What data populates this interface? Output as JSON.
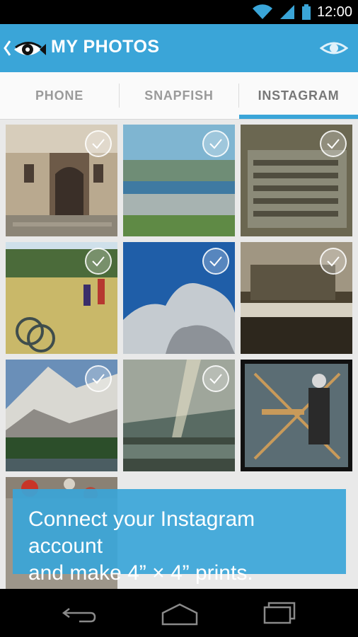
{
  "status_bar": {
    "time": "12:00"
  },
  "action_bar": {
    "title": "MY PHOTOS"
  },
  "tabs": [
    {
      "label": "PHONE",
      "selected": false
    },
    {
      "label": "SNAPFISH",
      "selected": false
    },
    {
      "label": "INSTAGRAM",
      "selected": true
    }
  ],
  "photos": [
    {
      "subject": "building-doorway",
      "checked": false
    },
    {
      "subject": "lake-city-shoreline",
      "checked": false
    },
    {
      "subject": "letterpress-type",
      "checked": false
    },
    {
      "subject": "park-lawn-bicycle",
      "checked": false
    },
    {
      "subject": "tree-sky",
      "checked": false
    },
    {
      "subject": "workshop-interior",
      "checked": false
    },
    {
      "subject": "snowy-mountain",
      "checked": false
    },
    {
      "subject": "mountain-lake-sunbeam",
      "checked": false
    },
    {
      "subject": "loom-artisan",
      "checked": false
    },
    {
      "subject": "flowers-partial",
      "checked": false
    }
  ],
  "banner": {
    "line1": "Connect your Instagram account",
    "line2": "and make 4” × 4” prints."
  },
  "colors": {
    "accent": "#3aa5d8",
    "statusbar": "#000000",
    "navbar": "#000000"
  }
}
